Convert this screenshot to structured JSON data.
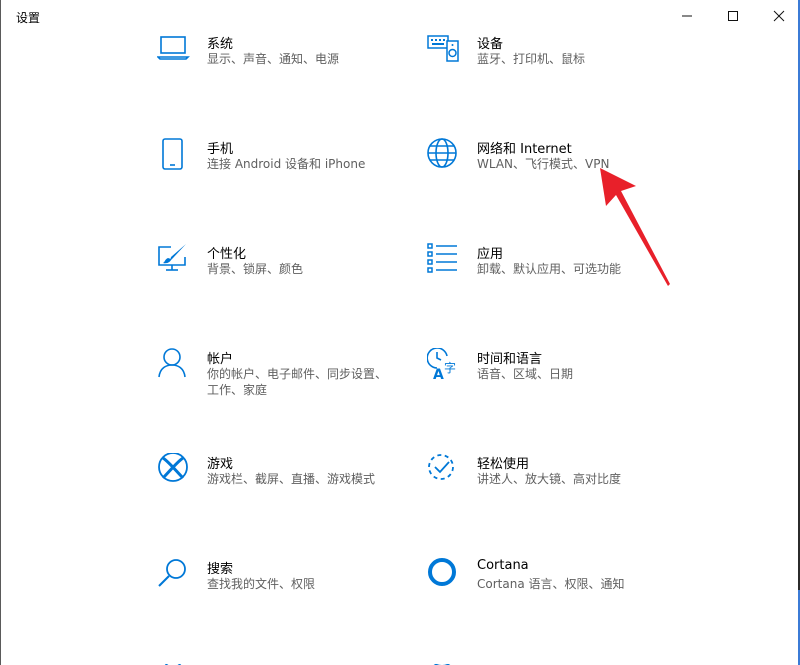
{
  "window": {
    "title": "设置",
    "minimize": "—",
    "maximize": "☐",
    "close": "✕"
  },
  "tiles": [
    {
      "label": "系统",
      "desc": "显示、声音、通知、电源",
      "icon": "laptop-icon"
    },
    {
      "label": "设备",
      "desc": "蓝牙、打印机、鼠标",
      "icon": "keyboard-speaker-icon"
    },
    {
      "label": "手机",
      "desc": "连接 Android 设备和 iPhone",
      "icon": "phone-icon"
    },
    {
      "label": "网络和 Internet",
      "desc": "WLAN、飞行模式、VPN",
      "icon": "globe-icon"
    },
    {
      "label": "个性化",
      "desc": "背景、锁屏、颜色",
      "icon": "paintbrush-monitor-icon"
    },
    {
      "label": "应用",
      "desc": "卸载、默认应用、可选功能",
      "icon": "apps-list-icon"
    },
    {
      "label": "帐户",
      "desc": "你的帐户、电子邮件、同步设置、工作、家庭",
      "icon": "person-icon"
    },
    {
      "label": "时间和语言",
      "desc": "语音、区域、日期",
      "icon": "time-language-icon"
    },
    {
      "label": "游戏",
      "desc": "游戏栏、截屏、直播、游戏模式",
      "icon": "xbox-icon"
    },
    {
      "label": "轻松使用",
      "desc": "讲述人、放大镜、高对比度",
      "icon": "ease-of-access-icon"
    },
    {
      "label": "搜索",
      "desc": "查找我的文件、权限",
      "icon": "search-icon"
    },
    {
      "label": "Cortana",
      "desc": "Cortana 语言、权限、通知",
      "icon": "cortana-icon"
    }
  ],
  "colors": {
    "accent": "#0078d7",
    "annotation_arrow": "#e8202a"
  }
}
